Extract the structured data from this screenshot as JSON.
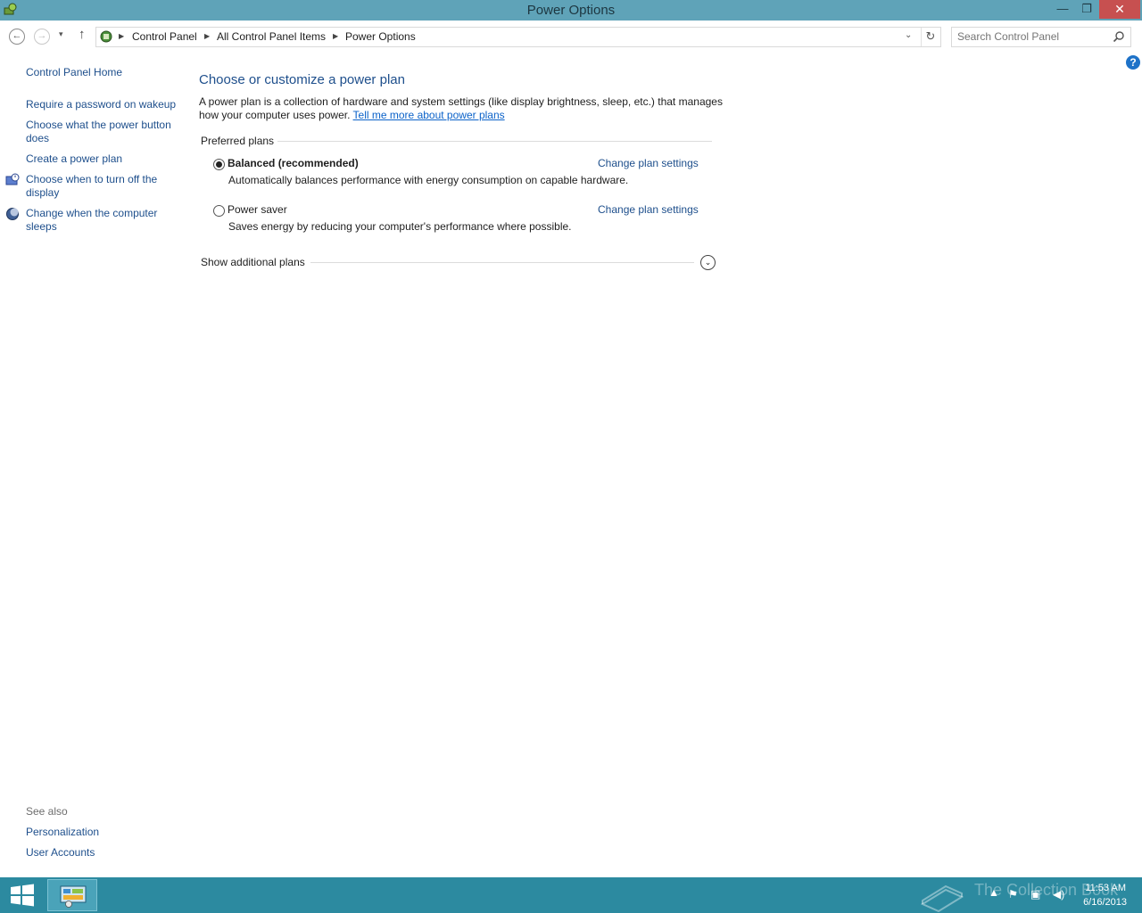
{
  "window": {
    "title": "Power Options",
    "minimize": "—",
    "maximize": "❐",
    "close": "✕"
  },
  "nav": {
    "back": "←",
    "forward": "→",
    "recent": "▾",
    "up": "↑"
  },
  "breadcrumb": [
    "Control Panel",
    "All Control Panel Items",
    "Power Options"
  ],
  "search": {
    "placeholder": "Search Control Panel"
  },
  "help": "?",
  "sidebar": {
    "home": "Control Panel Home",
    "items": [
      "Require a password on wakeup",
      "Choose what the power button does",
      "Create a power plan",
      "Choose when to turn off the display",
      "Change when the computer sleeps"
    ],
    "see_also_label": "See also",
    "see_also": [
      "Personalization",
      "User Accounts"
    ]
  },
  "main": {
    "title": "Choose or customize a power plan",
    "intro": "A power plan is a collection of hardware and system settings (like display brightness, sleep, etc.) that manages how your computer uses power.",
    "intro_link": "Tell me more about power plans",
    "preferred_label": "Preferred plans",
    "plans": [
      {
        "name": "Balanced (recommended)",
        "selected": true,
        "description": "Automatically balances performance with energy consumption on capable hardware.",
        "link": "Change plan settings"
      },
      {
        "name": "Power saver",
        "selected": false,
        "description": "Saves energy by reducing your computer's performance where possible.",
        "link": "Change plan settings"
      }
    ],
    "additional_label": "Show additional plans",
    "expand_glyph": "⌄"
  },
  "taskbar": {
    "watermark": "The Collection Book",
    "time": "11:53 AM",
    "date": "6/16/2013"
  },
  "colors": {
    "titlebar": "#5fa3b8",
    "taskbar": "#2c8aa0",
    "link": "#1e4f8c",
    "close": "#c75050"
  }
}
